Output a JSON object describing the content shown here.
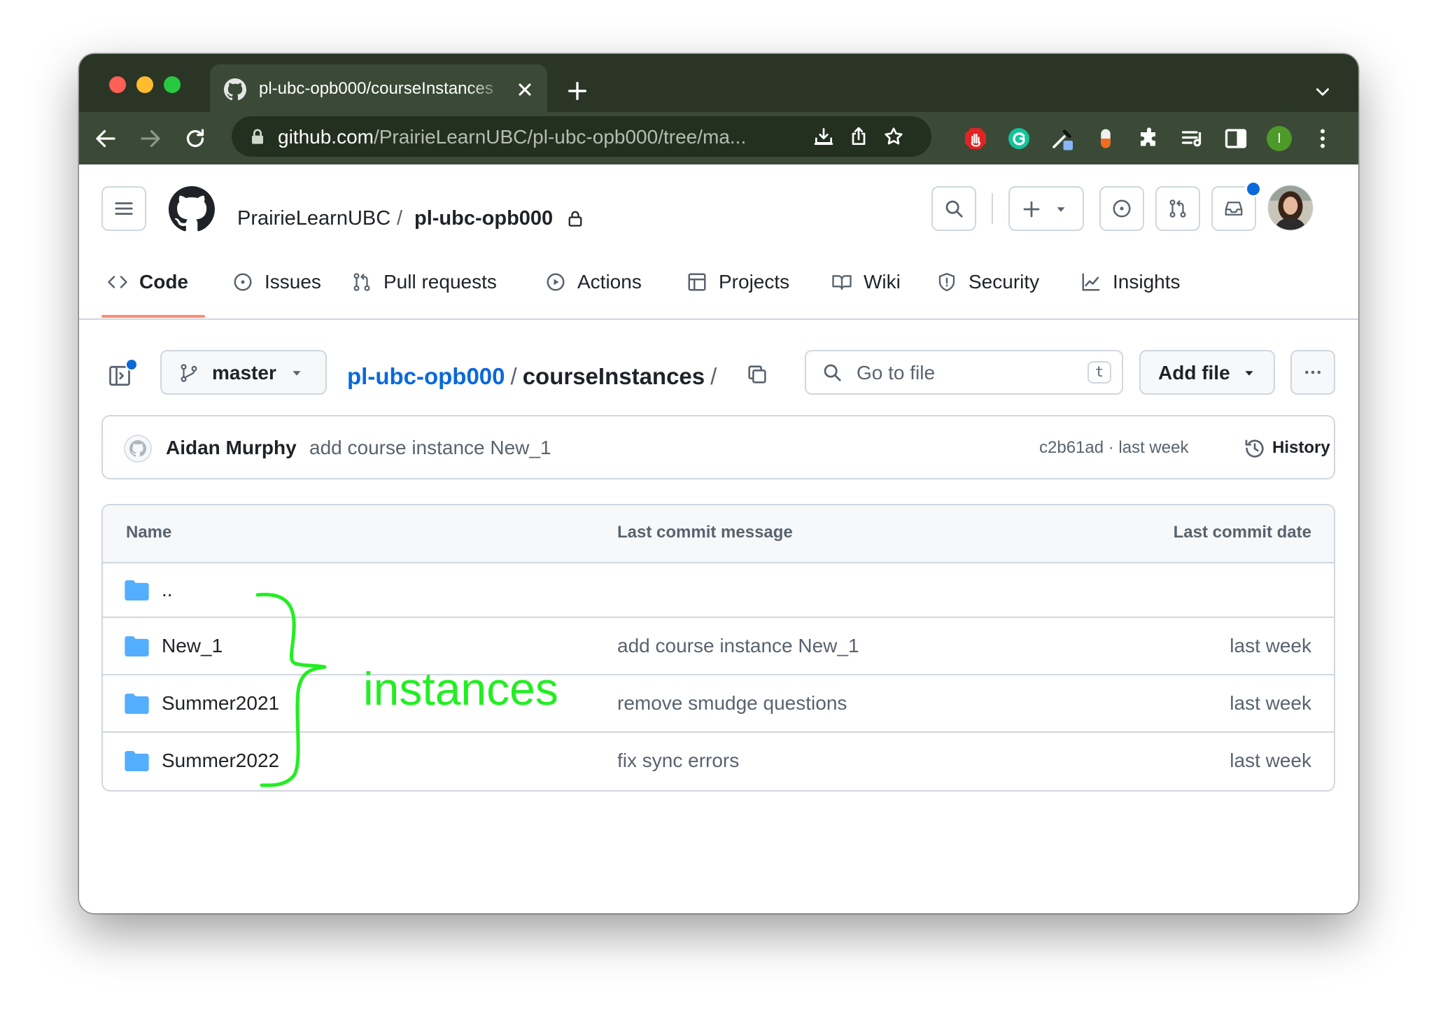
{
  "browser": {
    "tab_title": "pl-ubc-opb000/courseInstances",
    "url_host": "github.com",
    "url_path": "/PrairieLearnUBC/pl-ubc-opb000/tree/ma...",
    "profile_initial": "I"
  },
  "header": {
    "owner": "PrairieLearnUBC",
    "separator": "/",
    "repo": "pl-ubc-opb000"
  },
  "nav": {
    "code": "Code",
    "issues": "Issues",
    "pull_requests": "Pull requests",
    "actions": "Actions",
    "projects": "Projects",
    "wiki": "Wiki",
    "security": "Security",
    "insights": "Insights"
  },
  "branch": {
    "name": "master"
  },
  "path": {
    "repo": "pl-ubc-opb000",
    "sep": "/",
    "folder": "courseInstances"
  },
  "search": {
    "placeholder": "Go to file",
    "shortcut": "t"
  },
  "add_file_label": "Add file",
  "commit": {
    "author": "Aidan Murphy",
    "message": "add course instance New_1",
    "sha_date": "c2b61ad · last week",
    "history_label": "History"
  },
  "table": {
    "headers": {
      "name": "Name",
      "message": "Last commit message",
      "date": "Last commit date"
    },
    "parent": "..",
    "rows": [
      {
        "name": "New_1",
        "message": "add course instance New_1",
        "date": "last week"
      },
      {
        "name": "Summer2021",
        "message": "remove smudge questions",
        "date": "last week"
      },
      {
        "name": "Summer2022",
        "message": "fix sync errors",
        "date": "last week"
      }
    ]
  },
  "annotation": {
    "text": "instances",
    "color": "#22ee22"
  },
  "colors": {
    "link": "#0969da",
    "folder": "#54aeff",
    "chrome_dark": "#2a3526",
    "underline": "#fd8c73",
    "notification": "#0969da"
  }
}
